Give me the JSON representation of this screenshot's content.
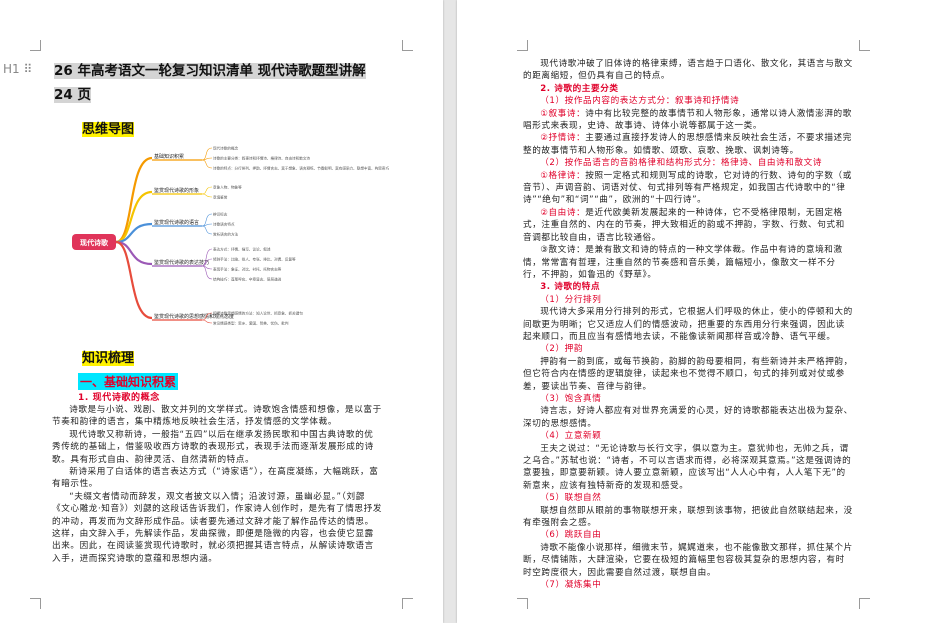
{
  "page1": {
    "heading_marker": "H1",
    "title": "26 年高考语文一轮复习知识清单 现代诗歌题型讲解 24 页",
    "mindmap_heading": "思维导图",
    "mindmap": {
      "center": "现代诗歌",
      "branches": [
        {
          "label": "基础知识积累",
          "color": "#f59a00",
          "leaves": [
            "现代诗歌的概念",
            "诗歌的主要分类：叙事诗和抒情诗、格律诗、自由诗和散文诗",
            "诗歌的特点：分行排列、押韵、抒情言志、富于想象、语言凝练、节奏鲜明、富有感染力、联想丰富、构思奇巧"
          ]
        },
        {
          "label": "鉴赏现代诗歌的形象",
          "color": "#f5c400",
          "leaves": [
            "意象人物、物象等",
            "意境鉴赏"
          ]
        },
        {
          "label": "鉴赏现代诗歌的语言",
          "color": "#4a90d9",
          "leaves": [
            "辨识标志",
            "诗歌语言特点",
            "赏析语言的方法"
          ]
        },
        {
          "label": "鉴赏现代诗歌的表达技巧",
          "color": "#9b59b6",
          "leaves": [
            "表达方式：抒情、描写、议论、叙述",
            "修辞手法：比喻、拟人、夸张、排比、对偶、反复等",
            "表现手法：象征、对比、衬托、托物言志等",
            "结构技巧：首尾呼应、卒章显志、层层递进"
          ]
        },
        {
          "label": "鉴赏现代诗歌的思想感情和观点态度",
          "color": "#e74c3c",
          "leaves": [
            "把握诗歌思想感情的方法：知人论世、抓意象、抓关键句",
            "常见情感类型：思乡、爱国、赞美、忧伤、批判"
          ]
        }
      ]
    },
    "knowledge_heading": "知识梳理",
    "section1": "一、基础知识积累",
    "sub1": "1. 现代诗歌的概念",
    "paragraphs": [
      "诗歌是与小说、戏剧、散文并列的文学样式。诗歌饱含情感和想像，是以富于节奏和韵律的语言，集中精炼地反映社会生活，抒发情感的文学体裁。",
      "现代诗歌又称新诗，一般指“五四”以后在继承发扬民歌和中国古典诗歌的优秀传统的基础上，借鉴吸收西方诗歌的表现形式，表现手法而逐渐发展形成的诗歌。具有形式自由、韵律灵活、自然清新的特点。",
      "新诗采用了白话体的语言表达方式（“诗家语”），在高度凝练，大幅跳跃，富有暗示性。",
      "“夫缀文者情动而辞发，观文者披文以入情；沿波讨源，虽幽必显。”（刘勰《文心雕龙·知音》）刘勰的这段话告诉我们，作家诗人创作时，是先有了情思抒发的冲动，再发而为文辞形成作品。读者要先通过文辞才能了解作品传达的情思。这样，由文辞入手，先解读作品，发曲探微，即便是隐微的内容，也会使它显露出来。因此，在阅读鉴赏现代诗歌时，就必须把握其语言特点，从解读诗歌语言入手，进而探究诗歌的意蕴和思想内涵。"
    ]
  },
  "page2": {
    "intro": "现代诗歌冲破了旧体诗的格律束缚，语言趋于口语化、散文化，其语言与散文的距离缩短，但仍具有自己的特点。",
    "sub2": "2. 诗歌的主要分类",
    "cat1": "（1）按作品内容的表达方式分：叙事诗和抒情诗",
    "cat1_a_label": "①叙事诗：",
    "cat1_a": "诗中有比较完整的故事情节和人物形象，通常以诗人激情澎湃的歌唱形式来表现，史诗、故事诗、诗体小说等都属于这一类。",
    "cat1_b_label": "②抒情诗：",
    "cat1_b": "主要通过直接抒发诗人的思想感情来反映社会生活，不要求描述完整的故事情节和人物形象。如情歌、颂歌、哀歌、挽歌、讽刺诗等。",
    "cat2": "（2）按作品语言的音韵格律和结构形式分：格律诗、自由诗和散文诗",
    "cat2_a_label": "①格律诗：",
    "cat2_a": "按照一定格式和规则写成的诗歌，它对诗的行数、诗句的字数（或音节）、声调音韵、词语对仗、句式排列等有严格规定，如我国古代诗歌中的“律诗”“绝句”和“词”“曲”，欧洲的“十四行诗”。",
    "cat2_b_label": "②自由诗：",
    "cat2_b": "是近代欧美新发展起来的一种诗体，它不受格律限制，无固定格式，注重自然的、内在的节奏，押大致相近的韵或不押韵，字数、行数、句式和音调都比较自由，语言比较通俗。",
    "cat2_c": "③散文诗：是兼有散文和诗的特点的一种文学体裁。作品中有诗的意境和激情，常常富有哲理，注重自然的节奏感和音乐美，篇幅短小，像散文一样不分行，不押韵，如鲁迅的《野草》。",
    "sub3": "3. 诗歌的特点",
    "f1": "（1）分行排列",
    "f1_text": "现代诗大多采用分行排列的形式，它根据人们呼吸的休止，使小的停顿和大的间歇更为明晰；它又适应人们的情感波动，把重要的东西用分行来强调，因此读起来顺口，而且应当有感情地去读，不能像读新闻那样音或冷静、语气平缓。",
    "f2": "（2）押韵",
    "f2_text": "押韵有一韵到底，或每节换韵，韵脚的韵母要相同，有些新诗并未严格押韵，但它符合内在情感的逻辑旋律，读起来也不觉得不顺口，句式的排列或对仗或参差，要读出节奏、音律与韵律。",
    "f3": "（3）饱含真情",
    "f3_text": "诗言志，好诗人都应有对世界充满爱的心灵，好的诗歌都能表达出极为复杂、深切的思想感情。",
    "f4": "（4）立意新颖",
    "f4_text": "王夫之说过：“无论诗歌与长行文字，俱以意为主。意犹帅也，无帅之兵，谓之乌合。”苏轼也说：“诗者，不可以言语求而得，必将深观其意焉。”这是强调诗的意要独，即意要新颖。诗人要立意新颖，应该写出“人人心中有，人人笔下无”的新意来，应该有独特新奇的发现和感受。",
    "f5": "（5）联想自然",
    "f5_text": "联想自然即从眼前的事物联想开来，联想到该事物，把彼此自然联结起来，没有牵强附会之感。",
    "f6": "（6）跳跃自由",
    "f6_text": "诗歌不能像小说那样，细微末节，娓娓道来，也不能像散文那样，抓住某个片断，尽情铺陈，大肆渲染，它要在极短的篇幅里包容极其复杂的思想内容，有时时空跨度很大，因此需要自然过渡，联想自由。",
    "f7": "（7）凝炼集中"
  }
}
